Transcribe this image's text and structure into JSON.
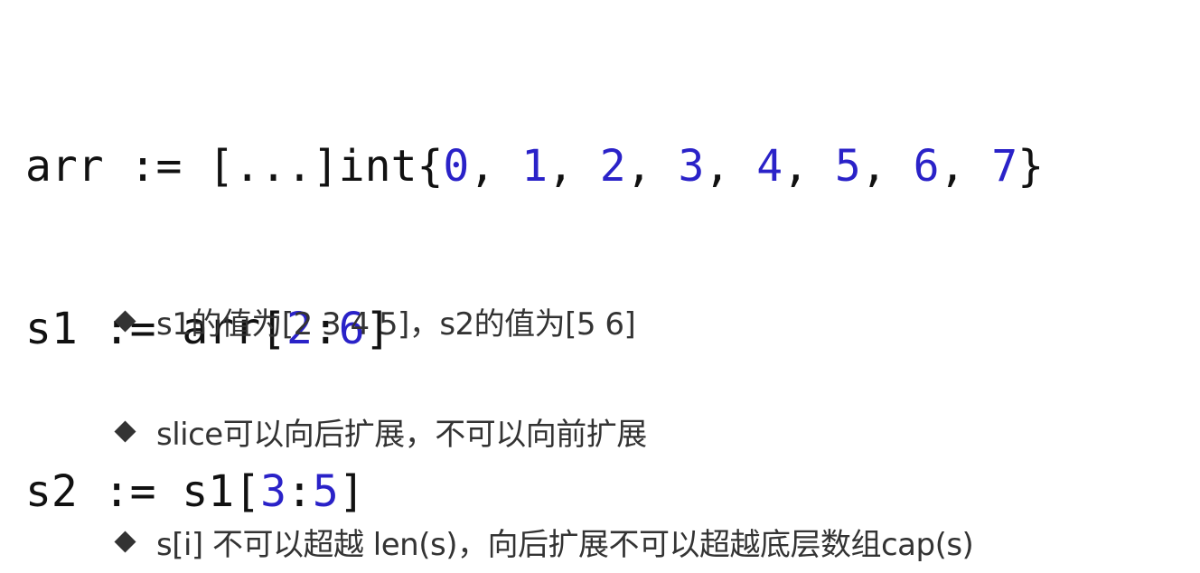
{
  "code": {
    "line1": {
      "prefix": "arr := [...]int{",
      "numbers": [
        "0",
        "1",
        "2",
        "3",
        "4",
        "5",
        "6",
        "7"
      ],
      "separator": ", ",
      "suffix": "}"
    },
    "line2": {
      "prefix": "s1 := arr[",
      "start": "2",
      "colon": ":",
      "end": "6",
      "suffix": "]"
    },
    "line3": {
      "prefix": "s2 := s1[",
      "start": "3",
      "colon": ":",
      "end": "5",
      "suffix": "]"
    }
  },
  "bullets": [
    {
      "icon": "diamond-icon",
      "text": "s1的值为[2 3 4 5]，s2的值为[5 6]"
    },
    {
      "icon": "diamond-icon",
      "text": "slice可以向后扩展，不可以向前扩展"
    },
    {
      "icon": "diamond-icon",
      "text": "s[i] 不可以超越 len(s)，向后扩展不可以超越底层数组cap(s)"
    }
  ],
  "colors": {
    "number": "#2a22c8",
    "code_text": "#111111",
    "bullet_text": "#333333"
  }
}
